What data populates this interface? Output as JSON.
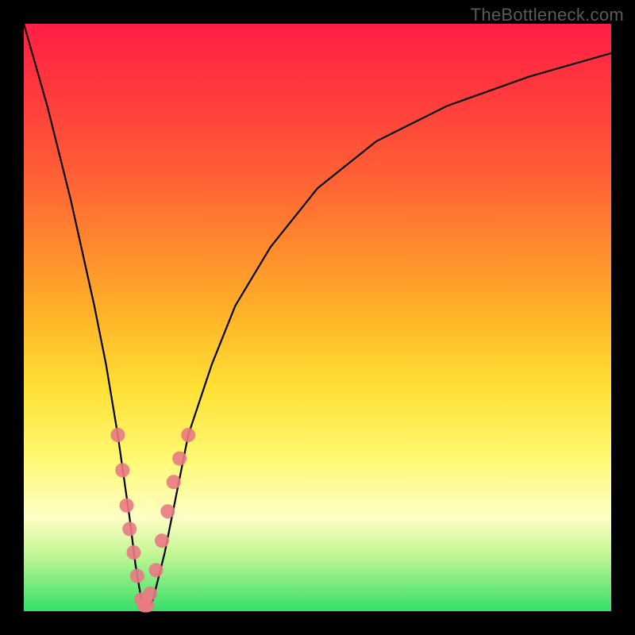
{
  "watermark": "TheBottleneck.com",
  "chart_data": {
    "type": "line",
    "title": "",
    "xlabel": "",
    "ylabel": "",
    "xlim": [
      0,
      100
    ],
    "ylim": [
      0,
      100
    ],
    "grid": false,
    "legend": false,
    "annotations": [],
    "series": [
      {
        "name": "bottleneck-curve",
        "color": "#000000",
        "x": [
          0,
          4,
          8,
          12,
          14,
          16,
          18,
          19,
          20,
          21,
          22,
          24,
          26,
          28,
          32,
          36,
          42,
          50,
          60,
          72,
          86,
          100
        ],
        "values": [
          100,
          86,
          70,
          52,
          42,
          30,
          16,
          8,
          2,
          0,
          2,
          10,
          20,
          30,
          42,
          52,
          62,
          72,
          80,
          86,
          91,
          95
        ]
      },
      {
        "name": "markers",
        "color": "#e97a82",
        "x": [
          16.0,
          16.8,
          17.5,
          18.0,
          18.7,
          19.3,
          20.0,
          20.5,
          21.0,
          21.5,
          22.5,
          23.5,
          24.5,
          25.5,
          26.5,
          28.0
        ],
        "values": [
          30.0,
          24.0,
          18.0,
          14.0,
          10.0,
          6.0,
          2.0,
          1.0,
          1.0,
          3.0,
          7.0,
          12.0,
          17.0,
          22.0,
          26.0,
          30.0
        ]
      }
    ],
    "background_gradient": {
      "direction": "vertical-top-to-bottom",
      "stops": [
        {
          "pos": 0.0,
          "color": "#ff1f45"
        },
        {
          "pos": 0.5,
          "color": "#ffb528"
        },
        {
          "pos": 0.8,
          "color": "#fff972"
        },
        {
          "pos": 1.0,
          "color": "#35e06a"
        }
      ]
    }
  }
}
